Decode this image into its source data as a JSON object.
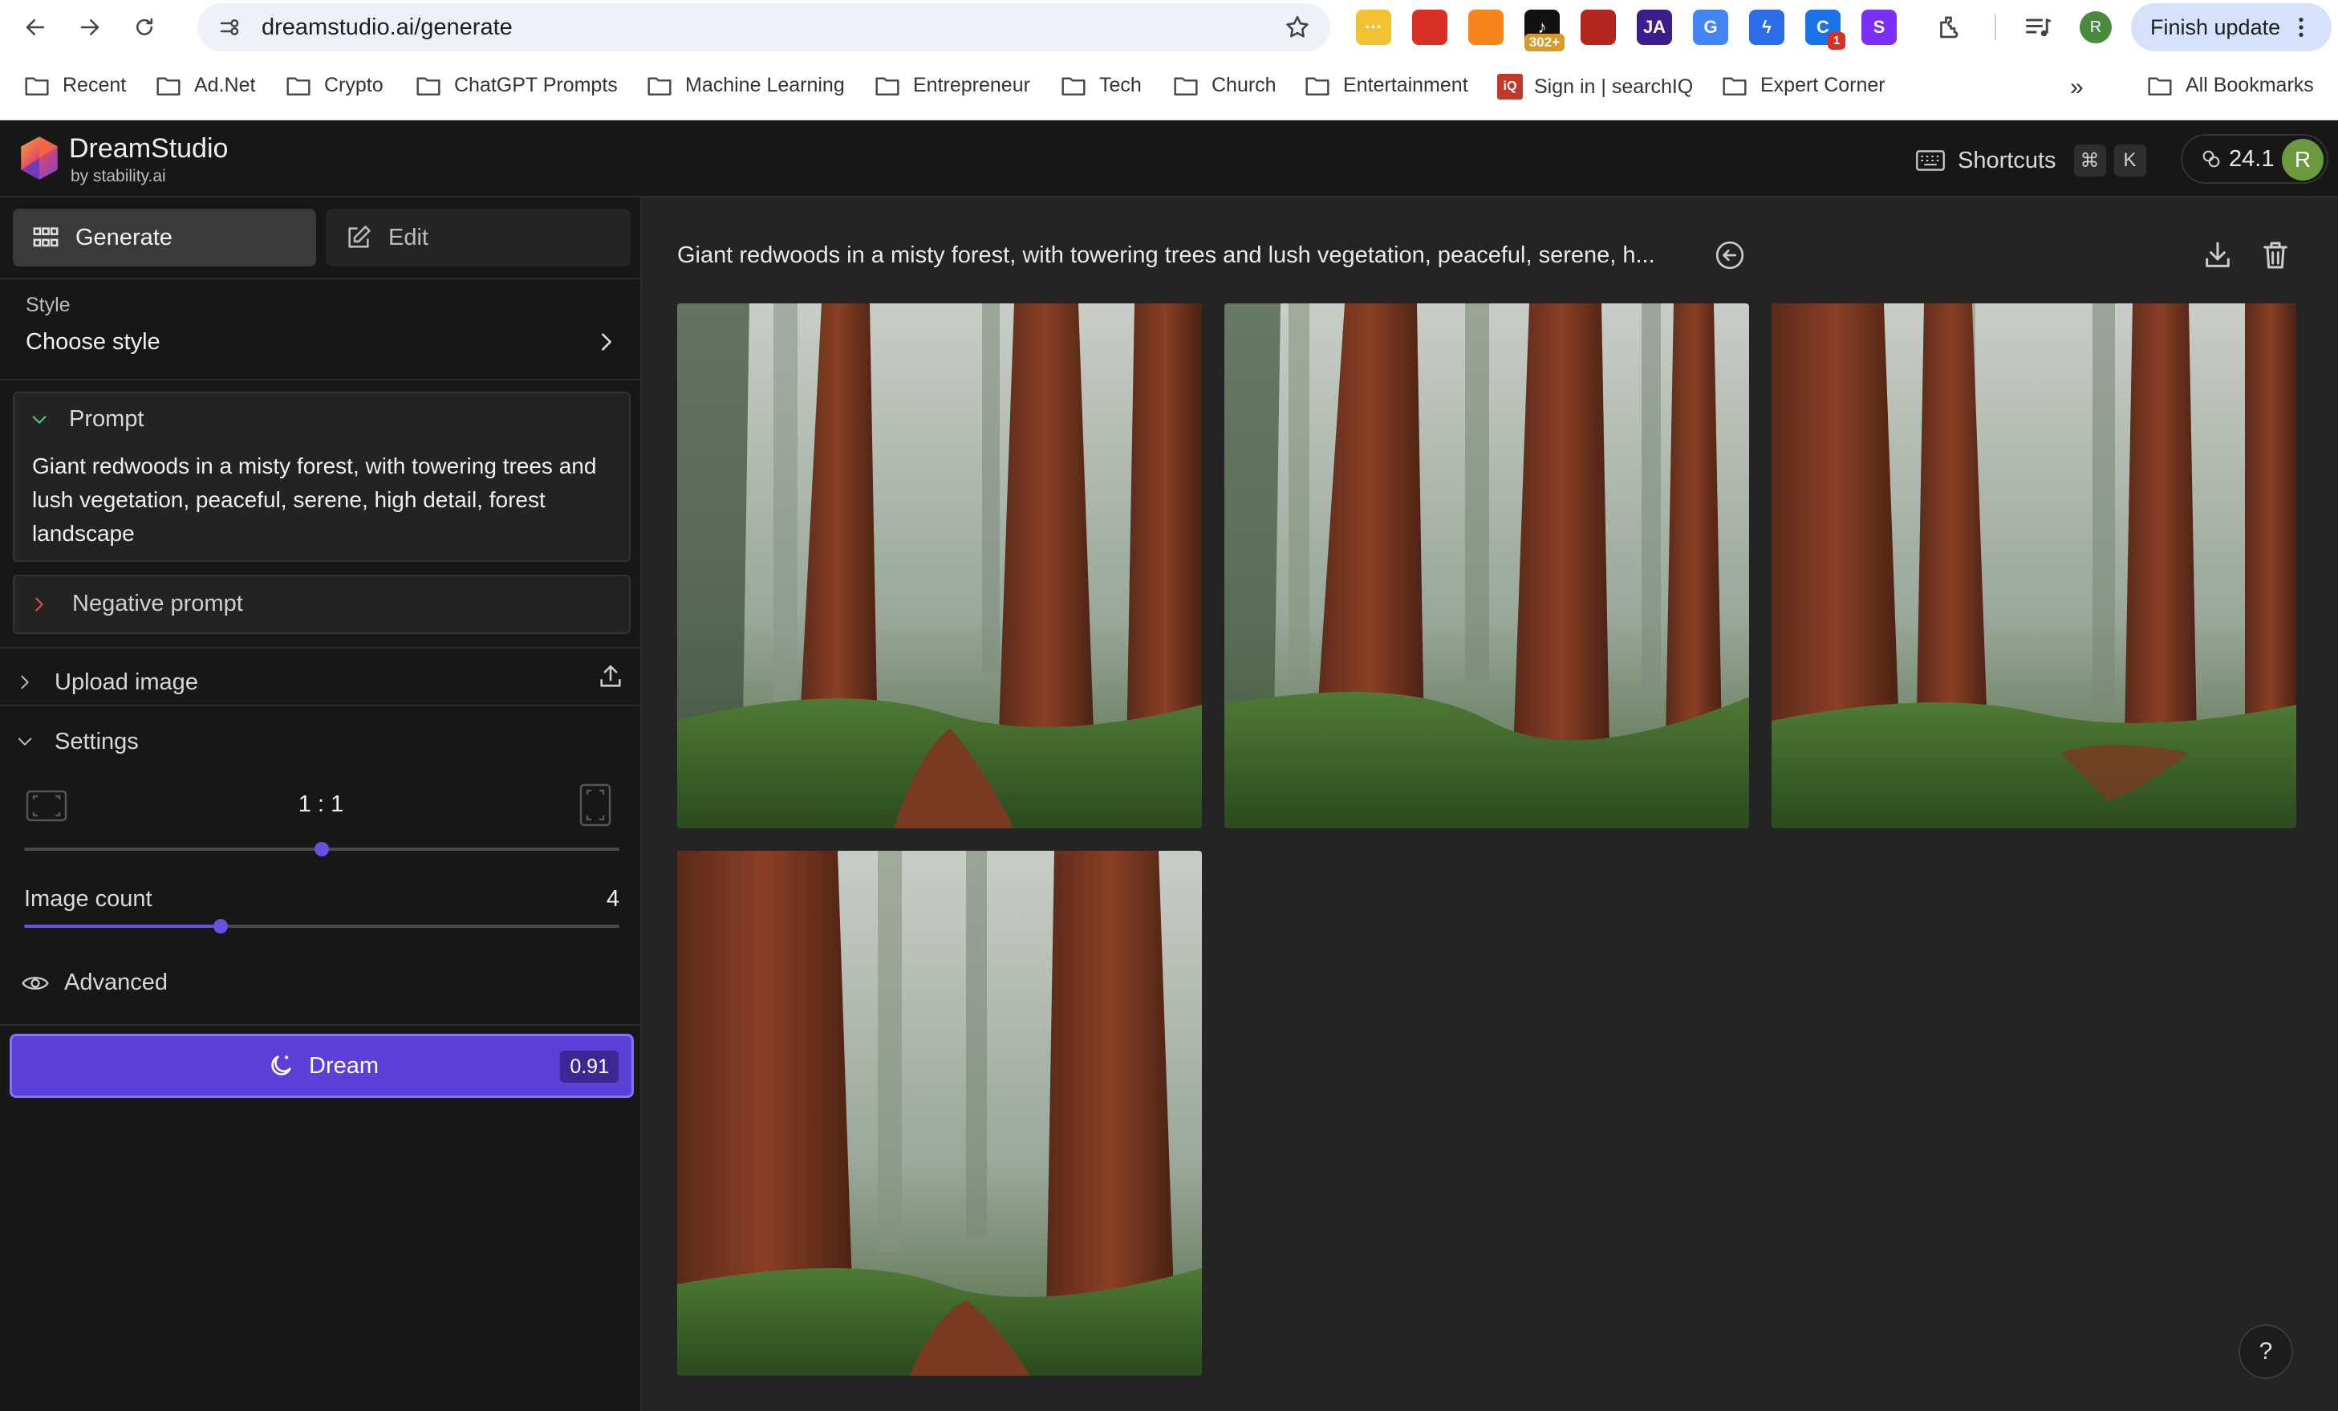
{
  "browser": {
    "url": "dreamstudio.ai/generate",
    "extensions": [
      {
        "name": "notes-extension-icon",
        "color": "#f1c232",
        "text": "···"
      },
      {
        "name": "adblock-extension-icon",
        "color": "#d93025",
        "text": ""
      },
      {
        "name": "metamask-extension-icon",
        "color": "#f6851b",
        "text": ""
      },
      {
        "name": "music-extension-icon",
        "color": "#111111",
        "text": "♪",
        "badge": "302+"
      },
      {
        "name": "pdf-extension-icon",
        "color": "#b3261e",
        "text": ""
      },
      {
        "name": "jasper-extension-icon",
        "color": "#3b1e8c",
        "text": "JA"
      },
      {
        "name": "translate-extension-icon",
        "color": "#4285f4",
        "text": "G"
      },
      {
        "name": "bolt-extension-icon",
        "color": "#2b6de8",
        "text": "ϟ"
      },
      {
        "name": "grammar-extension-icon",
        "color": "#1a73e8",
        "text": "C",
        "badge_red": "1"
      },
      {
        "name": "purple-extension-icon",
        "color": "#7b2ff7",
        "text": "S"
      }
    ],
    "profile_initial": "R",
    "finish_update": "Finish update",
    "bookmarks": [
      "Recent",
      "Ad.Net",
      "Crypto",
      "ChatGPT Prompts",
      "Machine Learning",
      "Entrepreneur",
      "Tech",
      "Church",
      "Entertainment",
      "Sign in | searchIQ",
      "Expert Corner"
    ],
    "all_bookmarks": "All Bookmarks"
  },
  "header": {
    "brand": "DreamStudio",
    "brand_sub": "by stability.ai",
    "shortcuts_label": "Shortcuts",
    "shortcut_keys": [
      "⌘",
      "K"
    ],
    "credits": "24.1",
    "user_initial": "R"
  },
  "sidebar": {
    "tabs": {
      "generate": "Generate",
      "edit": "Edit"
    },
    "style": {
      "label": "Style",
      "value": "Choose style"
    },
    "prompt": {
      "title": "Prompt",
      "text": "Giant redwoods in a misty forest, with towering trees and lush vegetation, peaceful, serene, high detail, forest landscape"
    },
    "negative_prompt": "Negative prompt",
    "upload_image": "Upload image",
    "settings": {
      "title": "Settings",
      "aspect_ratio": "1 : 1",
      "aspect_ratio_position": 0.5,
      "image_count_label": "Image count",
      "image_count": "4",
      "image_count_position": 0.33
    },
    "advanced": "Advanced",
    "dream_button": {
      "label": "Dream",
      "cost": "0.91"
    }
  },
  "main": {
    "result_prompt": "Giant redwoods in a misty forest, with towering trees and lush vegetation, peaceful, serene, h...",
    "image_count": 4,
    "help": "?"
  },
  "colors": {
    "accent": "#5b3fd6",
    "background": "#242424",
    "sidebar": "#171717"
  }
}
